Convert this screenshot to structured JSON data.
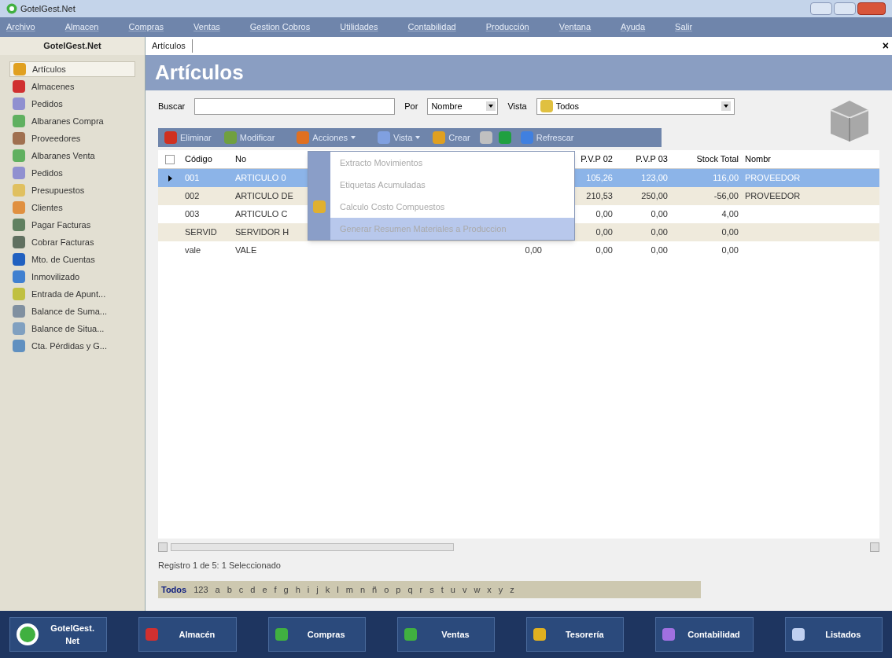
{
  "window": {
    "title": "GotelGest.Net"
  },
  "menu_bar": [
    "Archivo",
    "Almacen",
    "Compras",
    "Ventas",
    "Gestion Cobros",
    "Utilidades",
    "Contabilidad",
    "Producción",
    "Ventana",
    "Ayuda",
    "Salir"
  ],
  "sidebar": {
    "title": "GotelGest.Net",
    "items": [
      {
        "label": "Artículos",
        "selected": true,
        "color": "#e0a020"
      },
      {
        "label": "Almacenes",
        "selected": false,
        "color": "#d03030"
      },
      {
        "label": "Pedidos",
        "selected": false,
        "color": "#9090d0"
      },
      {
        "label": "Albaranes Compra",
        "selected": false,
        "color": "#60b060"
      },
      {
        "label": "Proveedores",
        "selected": false,
        "color": "#a07050"
      },
      {
        "label": "Albaranes Venta",
        "selected": false,
        "color": "#60b060"
      },
      {
        "label": "Pedidos",
        "selected": false,
        "color": "#9090d0"
      },
      {
        "label": "Presupuestos",
        "selected": false,
        "color": "#e0c060"
      },
      {
        "label": "Clientes",
        "selected": false,
        "color": "#e09040"
      },
      {
        "label": "Pagar Facturas",
        "selected": false,
        "color": "#608060"
      },
      {
        "label": "Cobrar Facturas",
        "selected": false,
        "color": "#607060"
      },
      {
        "label": "Mto. de Cuentas",
        "selected": false,
        "color": "#2060c0"
      },
      {
        "label": "Inmovilizado",
        "selected": false,
        "color": "#4080d0"
      },
      {
        "label": "Entrada de Apunt...",
        "selected": false,
        "color": "#c0c040"
      },
      {
        "label": "Balance de Suma...",
        "selected": false,
        "color": "#8090a0"
      },
      {
        "label": "Balance de Situa...",
        "selected": false,
        "color": "#80a0c0"
      },
      {
        "label": "Cta. Pérdidas y G...",
        "selected": false,
        "color": "#6090c0"
      }
    ]
  },
  "doc_tab": {
    "label": "Artículos",
    "close": "×"
  },
  "page_title": "Artículos",
  "filters": {
    "search_label": "Buscar",
    "by_label": "Por",
    "by_value": "Nombre",
    "view_label": "Vista",
    "view_value": "Todos"
  },
  "toolbar": [
    {
      "label": "Eliminar",
      "kind": "button",
      "color": "#d03020"
    },
    {
      "label": "Modificar",
      "kind": "button",
      "color": "#70a040"
    },
    {
      "label": "Acciones",
      "kind": "dropdown",
      "color": "#e07020"
    },
    {
      "label": "Vista",
      "kind": "dropdown",
      "color": "#80a0e0"
    },
    {
      "label": "Crear",
      "kind": "button",
      "color": "#e0a020"
    },
    {
      "kind": "icon",
      "color": "#c0c0c0"
    },
    {
      "kind": "icon",
      "color": "#20a040"
    },
    {
      "label": "Refrescar",
      "kind": "button",
      "color": "#4080e0"
    }
  ],
  "actions_menu": [
    {
      "label": "Extracto Movimientos",
      "disabled": true,
      "selected": false,
      "icon": false
    },
    {
      "label": "Etiquetas Acumuladas",
      "disabled": true,
      "selected": false,
      "icon": false
    },
    {
      "label": "Calculo Costo Compuestos",
      "disabled": true,
      "selected": false,
      "icon": true
    },
    {
      "label": "Generar Resumen Materiales a Produccion",
      "disabled": true,
      "selected": true,
      "icon": false
    }
  ],
  "table": {
    "select_all_checked": false,
    "columns": [
      "Código",
      "No",
      null,
      "P.V.P 02",
      "P.V.P 03",
      "Stock Total",
      "Nombr"
    ],
    "rows": [
      {
        "selected": true,
        "cells": [
          "001",
          "ARTICULO 0",
          null,
          "105,26",
          "123,00",
          "116,00",
          "PROVEEDOR"
        ]
      },
      {
        "selected": false,
        "cells": [
          "002",
          "ARTICULO DE",
          null,
          "210,53",
          "250,00",
          "-56,00",
          "PROVEEDOR"
        ]
      },
      {
        "selected": false,
        "cells": [
          "003",
          "ARTICULO C",
          null,
          "0,00",
          "0,00",
          "4,00",
          null
        ]
      },
      {
        "selected": false,
        "cells": [
          "SERVID",
          "SERVIDOR H",
          null,
          "0,00",
          "0,00",
          "0,00",
          null
        ]
      },
      {
        "selected": false,
        "cells": [
          "vale",
          "VALE",
          "0,00",
          "0,00",
          "0,00",
          "0,00",
          null
        ]
      }
    ]
  },
  "status": "Registro 1 de 5: 1 Seleccionado",
  "alphabet": [
    {
      "label": "Todos",
      "selected": true
    },
    {
      "label": "123",
      "selected": false
    },
    {
      "label": "a",
      "selected": false
    },
    {
      "label": "b",
      "selected": false
    },
    {
      "label": "c",
      "selected": false
    },
    {
      "label": "d",
      "selected": false
    },
    {
      "label": "e",
      "selected": false
    },
    {
      "label": "f",
      "selected": false
    },
    {
      "label": "g",
      "selected": false
    },
    {
      "label": "h",
      "selected": false
    },
    {
      "label": "i",
      "selected": false
    },
    {
      "label": "j",
      "selected": false
    },
    {
      "label": "k",
      "selected": false
    },
    {
      "label": "l",
      "selected": false
    },
    {
      "label": "m",
      "selected": false
    },
    {
      "label": "n",
      "selected": false
    },
    {
      "label": "ñ",
      "selected": false
    },
    {
      "label": "o",
      "selected": false
    },
    {
      "label": "p",
      "selected": false
    },
    {
      "label": "q",
      "selected": false
    },
    {
      "label": "r",
      "selected": false
    },
    {
      "label": "s",
      "selected": false
    },
    {
      "label": "t",
      "selected": false
    },
    {
      "label": "u",
      "selected": false
    },
    {
      "label": "v",
      "selected": false
    },
    {
      "label": "w",
      "selected": false
    },
    {
      "label": "x",
      "selected": false
    },
    {
      "label": "y",
      "selected": false
    },
    {
      "label": "z",
      "selected": false
    }
  ],
  "bottom_bar": [
    {
      "label": "GotelGest. Net",
      "kind": "logo",
      "color": "#40b040"
    },
    {
      "label": "Almacén",
      "kind": "button",
      "color": "#d03030"
    },
    {
      "label": "Compras",
      "kind": "button",
      "color": "#40b040"
    },
    {
      "label": "Ventas",
      "kind": "button",
      "color": "#40b040"
    },
    {
      "label": "Tesorería",
      "kind": "button",
      "color": "#e0b020"
    },
    {
      "label": "Contabilidad",
      "kind": "button",
      "color": "#a070e0"
    },
    {
      "label": "Listados",
      "kind": "button",
      "color": "#c0d0f0"
    }
  ]
}
